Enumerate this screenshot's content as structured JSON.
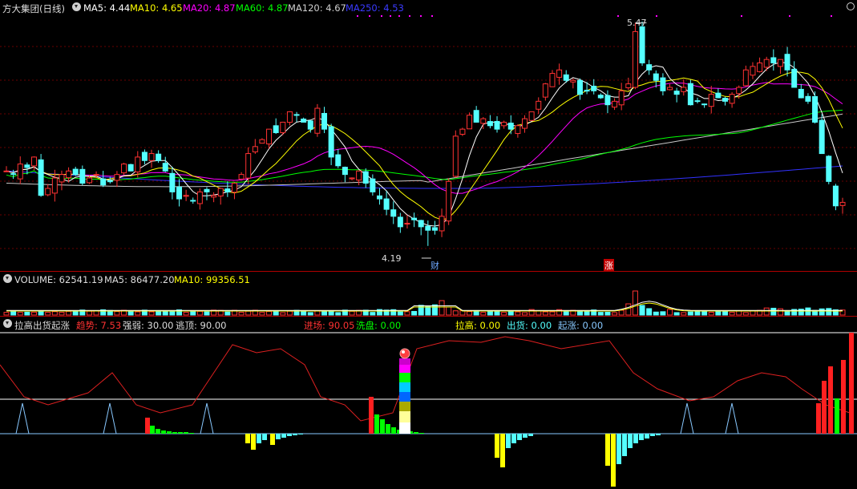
{
  "main": {
    "title": "方大集团(日线)",
    "ma5": "MA5: 4.44",
    "ma10": "MA10: 4.65",
    "ma20": "MA20: 4.87",
    "ma60": "MA60: 4.87",
    "ma120": "MA120: 4.67",
    "ma250": "MA250: 4.53",
    "high_label": "5.47",
    "low_label": "4.19",
    "event_cai": "财",
    "event_zhang": "涨"
  },
  "volume": {
    "label": "VOLUME: 62541.19",
    "ma5": "MA5: 86477.20",
    "ma10": "MA10: 99356.51"
  },
  "indicator": {
    "name": "拉高出货起涨",
    "trend": "趋势: 7.53",
    "strength": "强弱: 30.00",
    "escape": "逃顶: 90.00",
    "enter": "进场: 90.05",
    "wash": "洗盘: 0.00",
    "pull": "拉高: 0.00",
    "ship": "出货: 0.00",
    "rise": "起涨: 0.00"
  },
  "colors": {
    "up": "#ff3232",
    "down": "#54ffff",
    "ma5": "#ffffff",
    "ma10": "#ffff00",
    "ma20": "#ff00ff",
    "ma60": "#00ff00",
    "ma120": "#c8c8c8",
    "ma250": "#3232ff"
  },
  "chart_data": {
    "type": "candlestick",
    "price_range": [
      4.19,
      5.47
    ],
    "series": [
      {
        "name": "MA5",
        "value": 4.44
      },
      {
        "name": "MA10",
        "value": 4.65
      },
      {
        "name": "MA20",
        "value": 4.87
      },
      {
        "name": "MA60",
        "value": 4.87
      },
      {
        "name": "MA120",
        "value": 4.67
      },
      {
        "name": "MA250",
        "value": 4.53
      }
    ],
    "close": [
      4.62,
      4.6,
      4.66,
      4.64,
      4.7,
      4.48,
      4.52,
      4.58,
      4.6,
      4.62,
      4.6,
      4.55,
      4.58,
      4.6,
      4.54,
      4.56,
      4.6,
      4.66,
      4.62,
      4.7,
      4.68,
      4.72,
      4.68,
      4.62,
      4.5,
      4.46,
      4.48,
      4.45,
      4.5,
      4.5,
      4.48,
      4.52,
      4.5,
      4.55,
      4.6,
      4.72,
      4.76,
      4.8,
      4.86,
      4.84,
      4.9,
      4.96,
      4.94,
      4.9,
      4.86,
      4.98,
      4.86,
      4.7,
      4.65,
      4.6,
      4.58,
      4.62,
      4.55,
      4.5,
      4.46,
      4.4,
      4.36,
      4.3,
      4.32,
      4.34,
      4.3,
      4.28,
      4.28,
      4.36,
      4.56,
      4.82,
      4.86,
      4.94,
      4.9,
      4.92,
      4.88,
      4.86,
      4.9,
      4.86,
      4.88,
      4.92,
      4.96,
      5.02,
      5.12,
      5.18,
      5.2,
      5.14,
      5.14,
      5.06,
      5.08,
      5.08,
      5.04,
      5.0,
      5.02,
      5.08,
      5.12,
      5.42,
      5.24,
      5.2,
      5.14,
      5.08,
      5.1,
      5.06,
      5.1,
      5.0,
      5.02,
      5.0,
      5.06,
      5.04,
      5.02,
      5.06,
      5.1,
      5.2,
      5.22,
      5.24,
      5.26,
      5.24,
      5.26,
      5.2,
      5.1,
      5.04,
      5.02,
      4.9,
      4.72,
      4.56,
      4.42,
      4.44
    ],
    "volume": {
      "label": "VOLUME",
      "value": 62541.19,
      "ma5": 86477.2,
      "ma10": 99356.51
    },
    "indicator": {
      "name": "拉高出货起涨",
      "trend": 7.53,
      "strength": 30.0,
      "escape": 90.0,
      "enter": 90.05,
      "wash": 0.0,
      "pull": 0.0,
      "ship": 0.0,
      "rise": 0.0
    }
  }
}
